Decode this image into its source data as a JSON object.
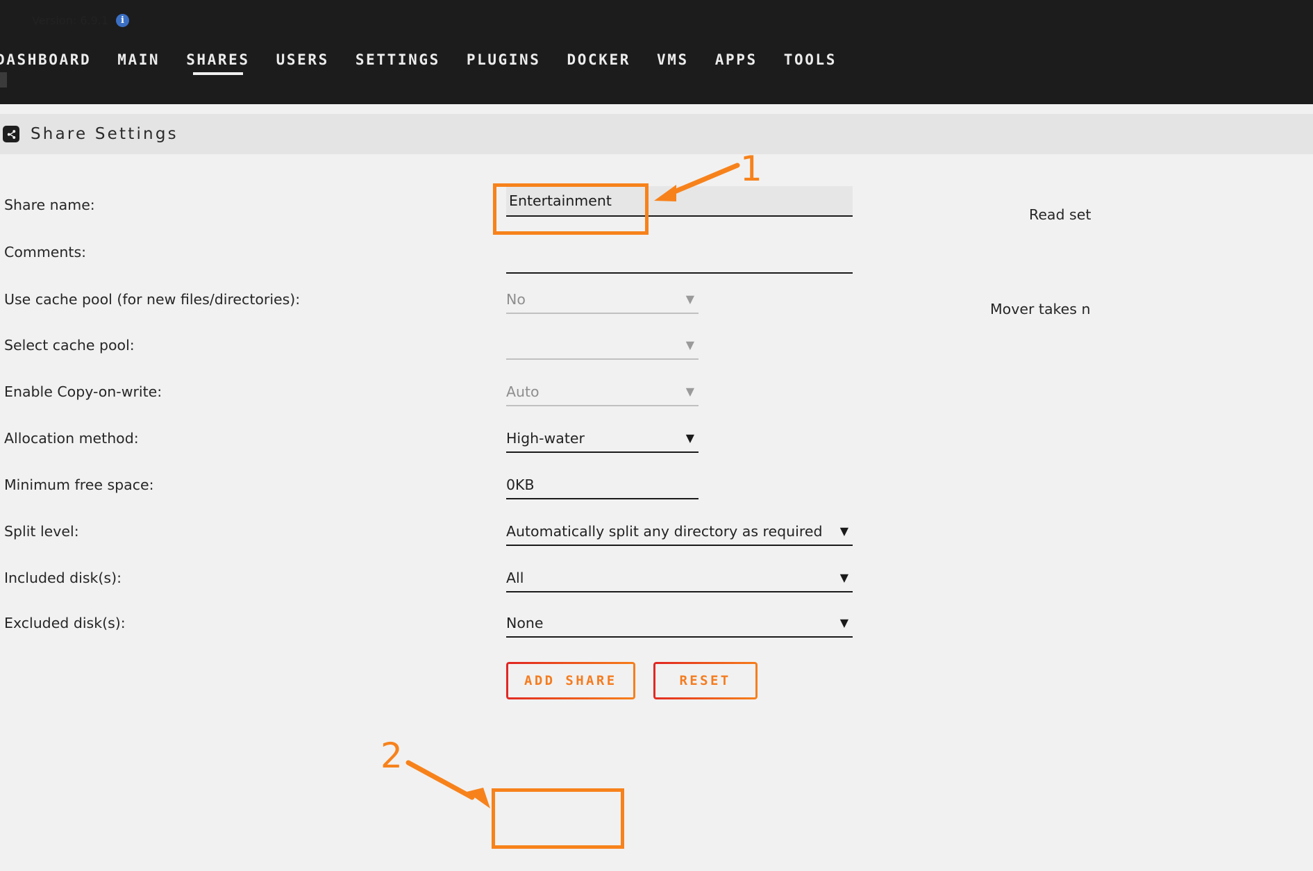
{
  "topbar": {
    "version_label": "Version: 6.9.1",
    "info_icon": "info-icon",
    "nav_items": [
      {
        "label": "DASHBOARD",
        "active": false
      },
      {
        "label": "MAIN",
        "active": false
      },
      {
        "label": "SHARES",
        "active": true
      },
      {
        "label": "USERS",
        "active": false
      },
      {
        "label": "SETTINGS",
        "active": false
      },
      {
        "label": "PLUGINS",
        "active": false
      },
      {
        "label": "DOCKER",
        "active": false
      },
      {
        "label": "VMS",
        "active": false
      },
      {
        "label": "APPS",
        "active": false
      },
      {
        "label": "TOOLS",
        "active": false
      }
    ]
  },
  "section": {
    "icon": "share-icon",
    "title": "Share Settings"
  },
  "form": {
    "rows": [
      {
        "label": "Share name:",
        "value": "Entertainment",
        "type": "text"
      },
      {
        "label": "Comments:",
        "value": "",
        "type": "text"
      },
      {
        "label": "Use cache pool (for new files/directories):",
        "value": "No",
        "type": "select",
        "disabled": true
      },
      {
        "label": "Select cache pool:",
        "value": "",
        "type": "select",
        "disabled": true
      },
      {
        "label": "Enable Copy-on-write:",
        "value": "Auto",
        "type": "select",
        "disabled": true
      },
      {
        "label": "Allocation method:",
        "value": "High-water",
        "type": "select",
        "disabled": false
      },
      {
        "label": "Minimum free space:",
        "value": "0KB",
        "type": "text"
      },
      {
        "label": "Split level:",
        "value": "Automatically split any directory as required",
        "type": "select",
        "disabled": false
      },
      {
        "label": "Included disk(s):",
        "value": "All",
        "type": "select",
        "disabled": false
      },
      {
        "label": "Excluded disk(s):",
        "value": "None",
        "type": "select",
        "disabled": false
      }
    ],
    "share_name_placeholder": ""
  },
  "help_column": [
    {
      "text": "Read set"
    },
    {
      "text": "Mover takes n"
    }
  ],
  "buttons": {
    "add_share": "ADD SHARE",
    "reset": "RESET"
  },
  "annotations": {
    "step1": "1",
    "step2": "2",
    "accent_color": "#f7821b"
  }
}
